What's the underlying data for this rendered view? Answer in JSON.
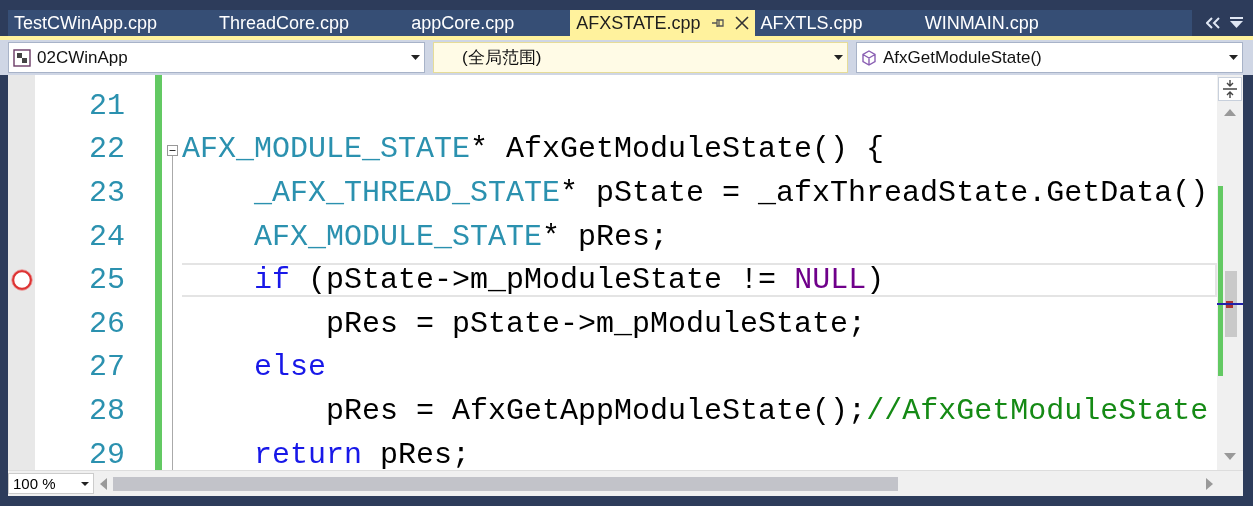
{
  "tabs": [
    {
      "label": "TestCWinApp.cpp",
      "selected": false
    },
    {
      "label": "ThreadCore.cpp",
      "selected": false
    },
    {
      "label": "appCore.cpp",
      "selected": false
    },
    {
      "label": "AFXSTATE.cpp",
      "selected": true
    },
    {
      "label": "AFXTLS.cpp",
      "selected": false
    },
    {
      "label": "WINMAIN.cpp",
      "selected": false
    }
  ],
  "navigation_bar": {
    "project": "02CWinApp",
    "scope": "(全局范围)",
    "member": "AfxGetModuleState()"
  },
  "editor": {
    "lines": [
      {
        "number": "21",
        "breakpoint": false,
        "highlighted": false
      },
      {
        "number": "22",
        "breakpoint": false,
        "highlighted": false,
        "tokens": [
          {
            "kind": "type",
            "text": "AFX_MODULE_STATE"
          },
          {
            "kind": "plain",
            "text": "* AfxGetModuleState() {"
          }
        ]
      },
      {
        "number": "23",
        "breakpoint": false,
        "highlighted": false,
        "tokens": [
          {
            "kind": "type",
            "text": "    _AFX_THREAD_STATE"
          },
          {
            "kind": "plain",
            "text": "* pState = _afxThreadState.GetData()"
          }
        ]
      },
      {
        "number": "24",
        "breakpoint": false,
        "highlighted": false,
        "tokens": [
          {
            "kind": "type",
            "text": "    AFX_MODULE_STATE"
          },
          {
            "kind": "plain",
            "text": "* pRes;"
          }
        ]
      },
      {
        "number": "25",
        "breakpoint": true,
        "highlighted": true,
        "tokens": [
          {
            "kind": "keyword",
            "text": "    if"
          },
          {
            "kind": "plain",
            "text": " (pState->m_pModuleState != "
          },
          {
            "kind": "macro",
            "text": "NULL"
          },
          {
            "kind": "plain",
            "text": ")"
          }
        ]
      },
      {
        "number": "26",
        "breakpoint": false,
        "highlighted": false,
        "tokens": [
          {
            "kind": "plain",
            "text": "        pRes = pState->m_pModuleState;"
          }
        ]
      },
      {
        "number": "27",
        "breakpoint": false,
        "highlighted": false,
        "tokens": [
          {
            "kind": "keyword",
            "text": "    else"
          }
        ]
      },
      {
        "number": "28",
        "breakpoint": false,
        "highlighted": false,
        "tokens": [
          {
            "kind": "plain",
            "text": "        pRes = AfxGetAppModuleState();"
          },
          {
            "kind": "comment",
            "text": "//AfxGetModuleState"
          }
        ]
      },
      {
        "number": "29",
        "breakpoint": false,
        "highlighted": false,
        "tokens": [
          {
            "kind": "keyword",
            "text": "    return"
          },
          {
            "kind": "plain",
            "text": " pRes;"
          }
        ]
      }
    ]
  },
  "zoom": "100 %"
}
